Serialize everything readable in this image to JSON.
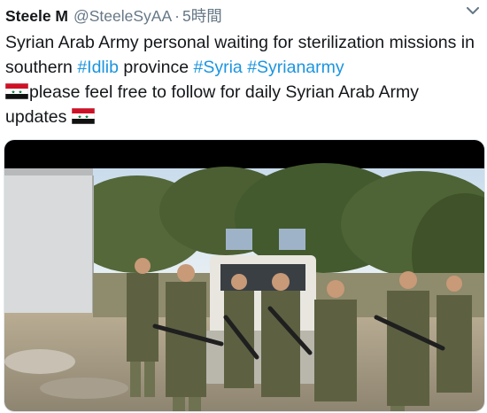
{
  "tweet": {
    "display_name": "Steele M",
    "handle": "@SteeleSyAA",
    "separator": "·",
    "timestamp": "5時間",
    "text_part1": "Syrian Arab Army personal waiting for sterilization missions in southern ",
    "hashtag_idlib": "#Idlib",
    "text_part2": " province ",
    "hashtag_syria": "#Syria",
    "text_space": " ",
    "hashtag_syrianarmy": "#Syrianarmy",
    "text_part3": "please feel free to follow for daily Syrian Arab Army updates",
    "flag_icon": "syria-flag-emoji",
    "caret_icon": "chevron-down-icon",
    "colors": {
      "hashtag": "#1b95e0",
      "meta": "#657786",
      "text": "#14171a"
    }
  },
  "media": {
    "type": "photo"
  }
}
